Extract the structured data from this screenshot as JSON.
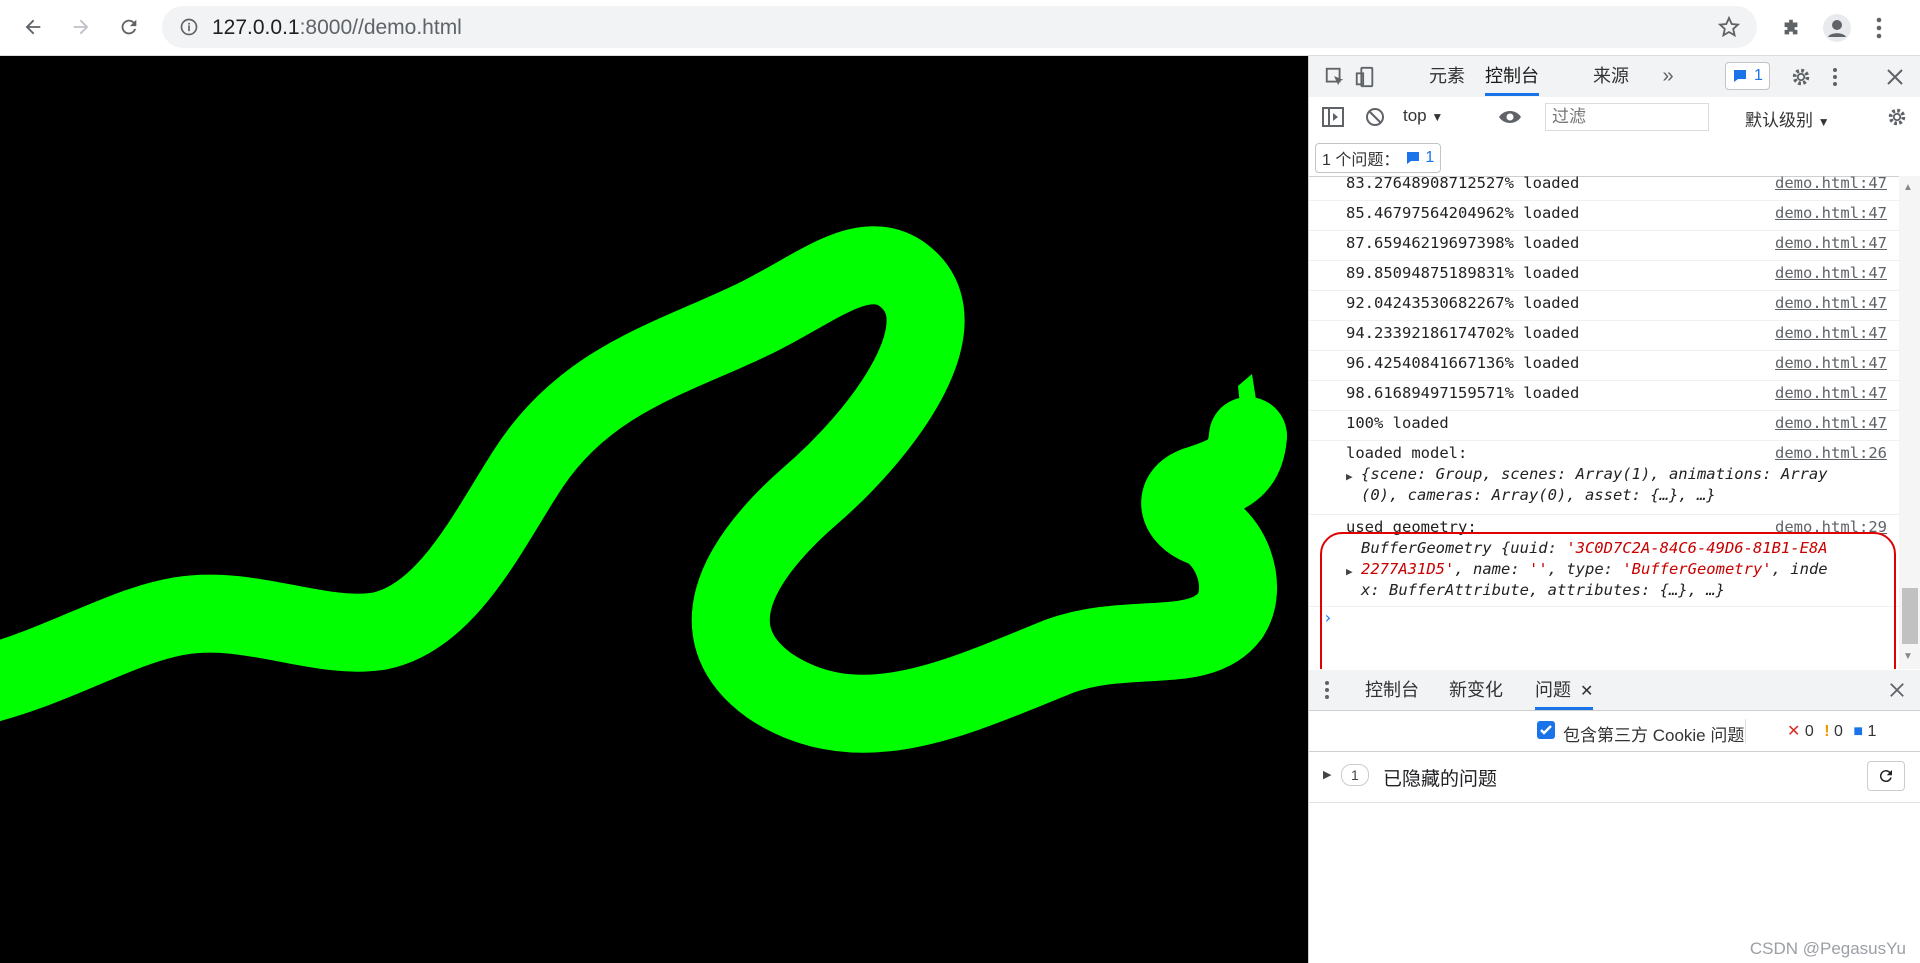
{
  "browser": {
    "url_host": "127.0.0.1",
    "url_rest": ":8000//demo.html"
  },
  "devtools": {
    "tabs": [
      "元素",
      "控制台",
      "来源"
    ],
    "issues_badge": "1",
    "toolbar": {
      "context": "top",
      "filter_placeholder": "过滤",
      "level": "默认级别"
    },
    "issues_summary": {
      "label": "1 个问题：",
      "count": "1"
    },
    "console_rows": [
      {
        "msg": "83.27648908712527% loaded",
        "link": "demo.html:47"
      },
      {
        "msg": "85.46797564204962% loaded",
        "link": "demo.html:47"
      },
      {
        "msg": "87.65946219697398% loaded",
        "link": "demo.html:47"
      },
      {
        "msg": "89.85094875189831% loaded",
        "link": "demo.html:47"
      },
      {
        "msg": "92.04243530682267% loaded",
        "link": "demo.html:47"
      },
      {
        "msg": "94.23392186174702% loaded",
        "link": "demo.html:47"
      },
      {
        "msg": "96.42540841667136% loaded",
        "link": "demo.html:47"
      },
      {
        "msg": "98.61689497159571% loaded",
        "link": "demo.html:47"
      },
      {
        "msg": "100% loaded",
        "link": "demo.html:47"
      }
    ],
    "model_log": {
      "label": "loaded model:",
      "link": "demo.html:26",
      "line1": "{scene: Group, scenes: Array(1), animations: Array",
      "line2": "(0), cameras: Array(0), asset: {…}, …}"
    },
    "geometry_log": {
      "label": "used geometry:",
      "link": "demo.html:29",
      "line1_a": "BufferGeometry {uuid: ",
      "line1_b": "'3C0D7C2A-84C6-49D6-81B1-E8A",
      "line2_a": "2277A31D5'",
      "line2_b": ", name: ",
      "line2_c": "''",
      "line2_d": ", type: ",
      "line2_e": "'BufferGeometry'",
      "line2_f": ", inde",
      "line3": "x: BufferAttribute, attributes: {…}, …}"
    },
    "drawer": {
      "tabs": [
        "控制台",
        "新变化",
        "问题"
      ],
      "third_party_cookie": "包含第三方 Cookie 问题",
      "errors": "0",
      "warnings": "0",
      "infos": "1",
      "hidden_count": "1",
      "hidden_label": "已隐藏的问题"
    }
  },
  "watermark": "CSDN @PegasusYu",
  "colors": {
    "snake": "#00ff00",
    "viewport_bg": "#000000",
    "highlight": "#e00000"
  }
}
